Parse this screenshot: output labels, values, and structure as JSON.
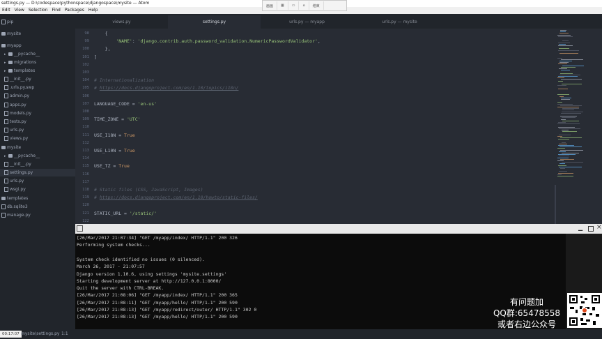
{
  "window": {
    "title": "settings.py — D:\\codespace\\pythonspace\\djangospace\\mysite — Atom"
  },
  "float_toolbar": {
    "left_label": "画画",
    "right_label": "结束"
  },
  "menu": [
    "Edit",
    "View",
    "Selection",
    "Find",
    "Packages",
    "Help"
  ],
  "tabs": [
    {
      "label": "views.py",
      "active": false
    },
    {
      "label": "settings.py",
      "active": true
    },
    {
      "label": "urls.py — myapp",
      "active": false
    },
    {
      "label": "urls.py — mysite",
      "active": false
    }
  ],
  "sidebar": {
    "items": [
      {
        "label": "pip",
        "type": "file",
        "depth": 0
      },
      {
        "label": "mysite",
        "type": "folder",
        "depth": 0
      },
      {
        "label": "myapp",
        "type": "folder",
        "depth": 0
      },
      {
        "label": "__pycache__",
        "type": "folder",
        "depth": 1
      },
      {
        "label": "migrations",
        "type": "folder",
        "depth": 1
      },
      {
        "label": "templates",
        "type": "folder",
        "depth": 1
      },
      {
        "label": "__init__.py",
        "type": "file",
        "depth": 1
      },
      {
        "label": ".urls.py.swp",
        "type": "file",
        "depth": 1
      },
      {
        "label": "admin.py",
        "type": "file",
        "depth": 1
      },
      {
        "label": "apps.py",
        "type": "file",
        "depth": 1
      },
      {
        "label": "models.py",
        "type": "file",
        "depth": 1
      },
      {
        "label": "tests.py",
        "type": "file",
        "depth": 1
      },
      {
        "label": "urls.py",
        "type": "file",
        "depth": 1
      },
      {
        "label": "views.py",
        "type": "file",
        "depth": 1
      },
      {
        "label": "mysite",
        "type": "folder",
        "depth": 0
      },
      {
        "label": "__pycache__",
        "type": "folder",
        "depth": 1
      },
      {
        "label": "__init__.py",
        "type": "file",
        "depth": 1
      },
      {
        "label": "settings.py",
        "type": "file",
        "depth": 1,
        "selected": true
      },
      {
        "label": "urls.py",
        "type": "file",
        "depth": 1
      },
      {
        "label": "wsgi.py",
        "type": "file",
        "depth": 1
      },
      {
        "label": "templates",
        "type": "folder",
        "depth": 0
      },
      {
        "label": "db.sqlite3",
        "type": "file",
        "depth": 0
      },
      {
        "label": "manage.py",
        "type": "file",
        "depth": 0
      }
    ]
  },
  "editor": {
    "lines": [
      {
        "n": "98",
        "parts": [
          [
            "    {",
            "p"
          ]
        ]
      },
      {
        "n": "99",
        "parts": [
          [
            "        ",
            "p"
          ],
          [
            "'NAME'",
            "s"
          ],
          [
            ": ",
            "p"
          ],
          [
            "'django.contrib.auth.password_validation.NumericPasswordValidator'",
            "s"
          ],
          [
            ",",
            "p"
          ]
        ]
      },
      {
        "n": "100",
        "parts": [
          [
            "    },",
            "p"
          ]
        ]
      },
      {
        "n": "101",
        "parts": [
          [
            "]",
            "p"
          ]
        ]
      },
      {
        "n": "102",
        "parts": []
      },
      {
        "n": "103",
        "parts": []
      },
      {
        "n": "104",
        "parts": [
          [
            "# Internationalization",
            "c"
          ]
        ]
      },
      {
        "n": "105",
        "parts": [
          [
            "# ",
            "c"
          ],
          [
            "https://docs.djangoproject.com/en/1.10/topics/i18n/",
            "u"
          ]
        ]
      },
      {
        "n": "106",
        "parts": []
      },
      {
        "n": "107",
        "parts": [
          [
            "LANGUAGE_CODE = ",
            "p"
          ],
          [
            "'en-us'",
            "s"
          ]
        ]
      },
      {
        "n": "108",
        "parts": []
      },
      {
        "n": "109",
        "parts": [
          [
            "TIME_ZONE = ",
            "p"
          ],
          [
            "'UTC'",
            "s"
          ]
        ]
      },
      {
        "n": "110",
        "parts": []
      },
      {
        "n": "111",
        "parts": [
          [
            "USE_I18N = ",
            "p"
          ],
          [
            "True",
            "k"
          ]
        ]
      },
      {
        "n": "112",
        "parts": []
      },
      {
        "n": "113",
        "parts": [
          [
            "USE_L10N = ",
            "p"
          ],
          [
            "True",
            "k"
          ]
        ]
      },
      {
        "n": "114",
        "parts": []
      },
      {
        "n": "115",
        "parts": [
          [
            "USE_TZ = ",
            "p"
          ],
          [
            "True",
            "k"
          ]
        ]
      },
      {
        "n": "116",
        "parts": []
      },
      {
        "n": "117",
        "parts": []
      },
      {
        "n": "118",
        "parts": [
          [
            "# Static files (CSS, JavaScript, Images)",
            "c"
          ]
        ]
      },
      {
        "n": "119",
        "parts": [
          [
            "# ",
            "c"
          ],
          [
            "https://docs.djangoproject.com/en/1.10/howto/static-files/",
            "u"
          ]
        ]
      },
      {
        "n": "120",
        "parts": []
      },
      {
        "n": "121",
        "parts": [
          [
            "STATIC_URL = ",
            "p"
          ],
          [
            "'/static/'",
            "s"
          ]
        ]
      },
      {
        "n": "122",
        "parts": []
      }
    ]
  },
  "terminal": {
    "lines": [
      "[26/Mar/2017 21:07:34] \"GET /myapp/index/ HTTP/1.1\" 200 326",
      "Performing system checks...",
      "",
      "System check identified no issues (0 silenced).",
      "March 26, 2017 - 21:07:57",
      "Django version 1.10.6, using settings 'mysite.settings'",
      "Starting development server at http://127.0.0.1:8000/",
      "Quit the server with CTRL-BREAK.",
      "[26/Mar/2017 21:08:06] \"GET /myapp/index/ HTTP/1.1\" 200 365",
      "[26/Mar/2017 21:08:11] \"GET /myapp/hello/ HTTP/1.1\" 200 590",
      "[26/Mar/2017 21:08:13] \"GET /myapp/redirect/outer/ HTTP/1.1\" 302 0",
      "[26/Mar/2017 21:08:13] \"GET /myapp/hello/ HTTP/1.1\" 200 590"
    ]
  },
  "watermark": {
    "line1": "有问题加",
    "line2": "QQ群:65478558",
    "line3": "或者右边公众号"
  },
  "status": {
    "time": "00:17:07",
    "file_path": "mysite\\settings.py",
    "cursor": "1:1"
  },
  "colors": {
    "string": "#98c379",
    "keyword": "#d19a66",
    "comment": "#5c6370",
    "editor_bg": "#282c34",
    "sidebar_bg": "#21252b"
  }
}
